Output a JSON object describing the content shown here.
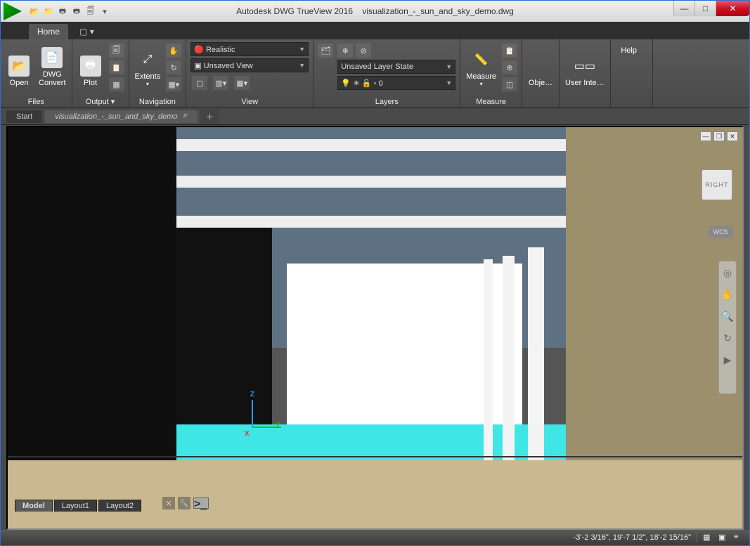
{
  "title": {
    "app": "Autodesk DWG TrueView 2016",
    "file": "visualization_-_sun_and_sky_demo.dwg"
  },
  "tabs": {
    "home": "Home"
  },
  "ribbon": {
    "files": {
      "title": "Files",
      "open": "Open",
      "convert": "DWG\nConvert"
    },
    "output": {
      "title": "Output ▾",
      "plot": "Plot"
    },
    "navigation": {
      "title": "Navigation",
      "extents": "Extents"
    },
    "view": {
      "title": "View",
      "visual_style": "Realistic",
      "named_view": "Unsaved View"
    },
    "layers": {
      "title": "Layers",
      "state": "Unsaved Layer State",
      "current": "0"
    },
    "measure": {
      "title": "Measure",
      "btn": "Measure"
    },
    "obj": "Obje…",
    "ui": "User Inte…",
    "help": "Help"
  },
  "doctabs": {
    "start": "Start",
    "file": "visualization_-_sun_and_sky_demo"
  },
  "viewcube": "RIGHT",
  "wcs": "WCS",
  "layouts": {
    "model": "Model",
    "l1": "Layout1",
    "l2": "Layout2"
  },
  "status": {
    "coords": "-3'-2 3/16\", 19'-7 1/2\", 18'-2 15/16\""
  }
}
